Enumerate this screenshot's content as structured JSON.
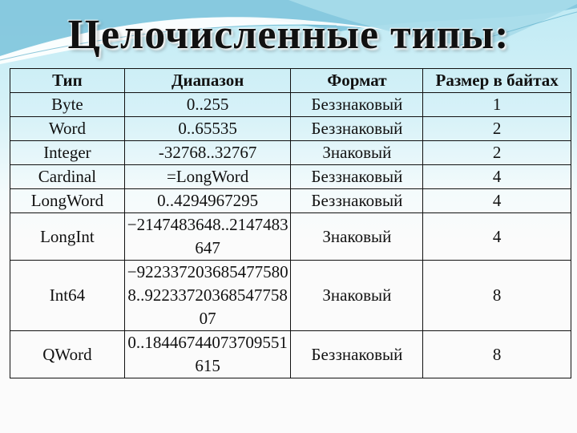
{
  "title": "Целочисленные типы:",
  "table": {
    "headers": [
      "Тип",
      "Диапазон",
      "Формат",
      "Размер в байтах"
    ],
    "rows": [
      {
        "type": "Byte",
        "range": "0..255",
        "format": "Беззнаковый",
        "size": "1"
      },
      {
        "type": "Word",
        "range": "0..65535",
        "format": "Беззнаковый",
        "size": "2"
      },
      {
        "type": "Integer",
        "range": "-32768..32767",
        "format": "Знаковый",
        "size": "2"
      },
      {
        "type": "Cardinal",
        "range": "=LongWord",
        "format": "Беззнаковый",
        "size": "4"
      },
      {
        "type": "LongWord",
        "range": "0..4294967295",
        "format": "Беззнаковый",
        "size": "4"
      },
      {
        "type": "LongInt",
        "range": "−2147483648..2147483647",
        "format": "Знаковый",
        "size": "4"
      },
      {
        "type": "Int64",
        "range": "−9223372036854775808..9223372036854775807",
        "format": "Знаковый",
        "size": "8"
      },
      {
        "type": "QWord",
        "range": "0..18446744073709551615",
        "format": "Беззнаковый",
        "size": "8"
      }
    ]
  }
}
